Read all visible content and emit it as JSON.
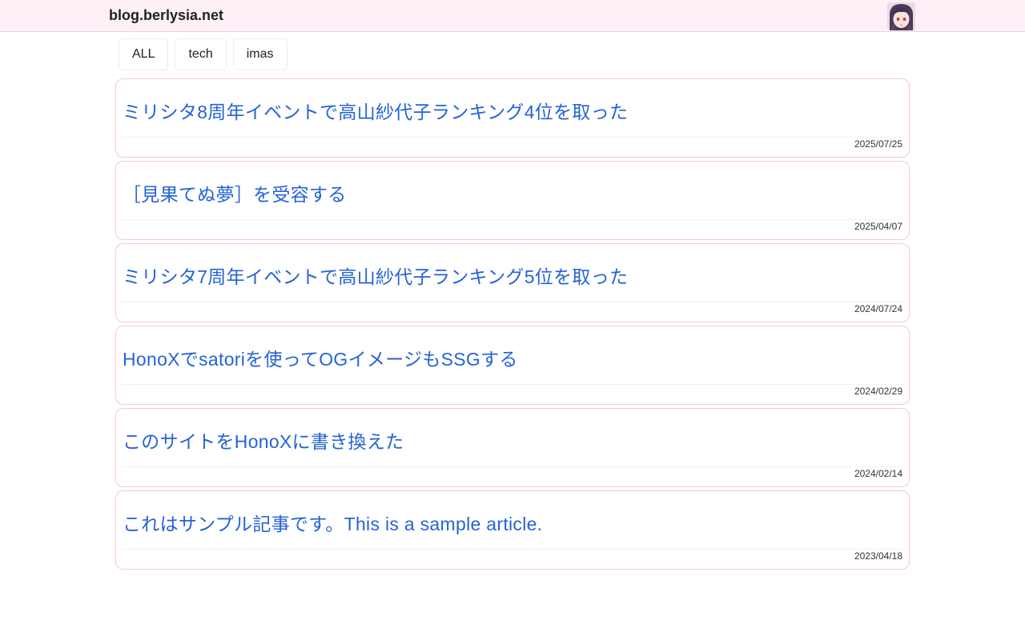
{
  "header": {
    "site_title": "blog.berlysia.net",
    "avatar_icon": "avatar-illustration-icon"
  },
  "tags": [
    {
      "label": "ALL"
    },
    {
      "label": "tech"
    },
    {
      "label": "imas"
    }
  ],
  "posts": [
    {
      "title": "ミリシタ8周年イベントで高山紗代子ランキング4位を取った",
      "date": "2025/07/25"
    },
    {
      "title": "［見果てぬ夢］を受容する",
      "date": "2025/04/07"
    },
    {
      "title": "ミリシタ7周年イベントで高山紗代子ランキング5位を取った",
      "date": "2024/07/24"
    },
    {
      "title": "HonoXでsatoriを使ってOGイメージもSSGする",
      "date": "2024/02/29"
    },
    {
      "title": "このサイトをHonoXに書き換えた",
      "date": "2024/02/14"
    },
    {
      "title": "これはサンプル記事です。This is a sample article.",
      "date": "2023/04/18"
    }
  ],
  "colors": {
    "header_bg": "#fdf1f7",
    "card_border": "#f4c6dd",
    "link": "#2563d6"
  }
}
